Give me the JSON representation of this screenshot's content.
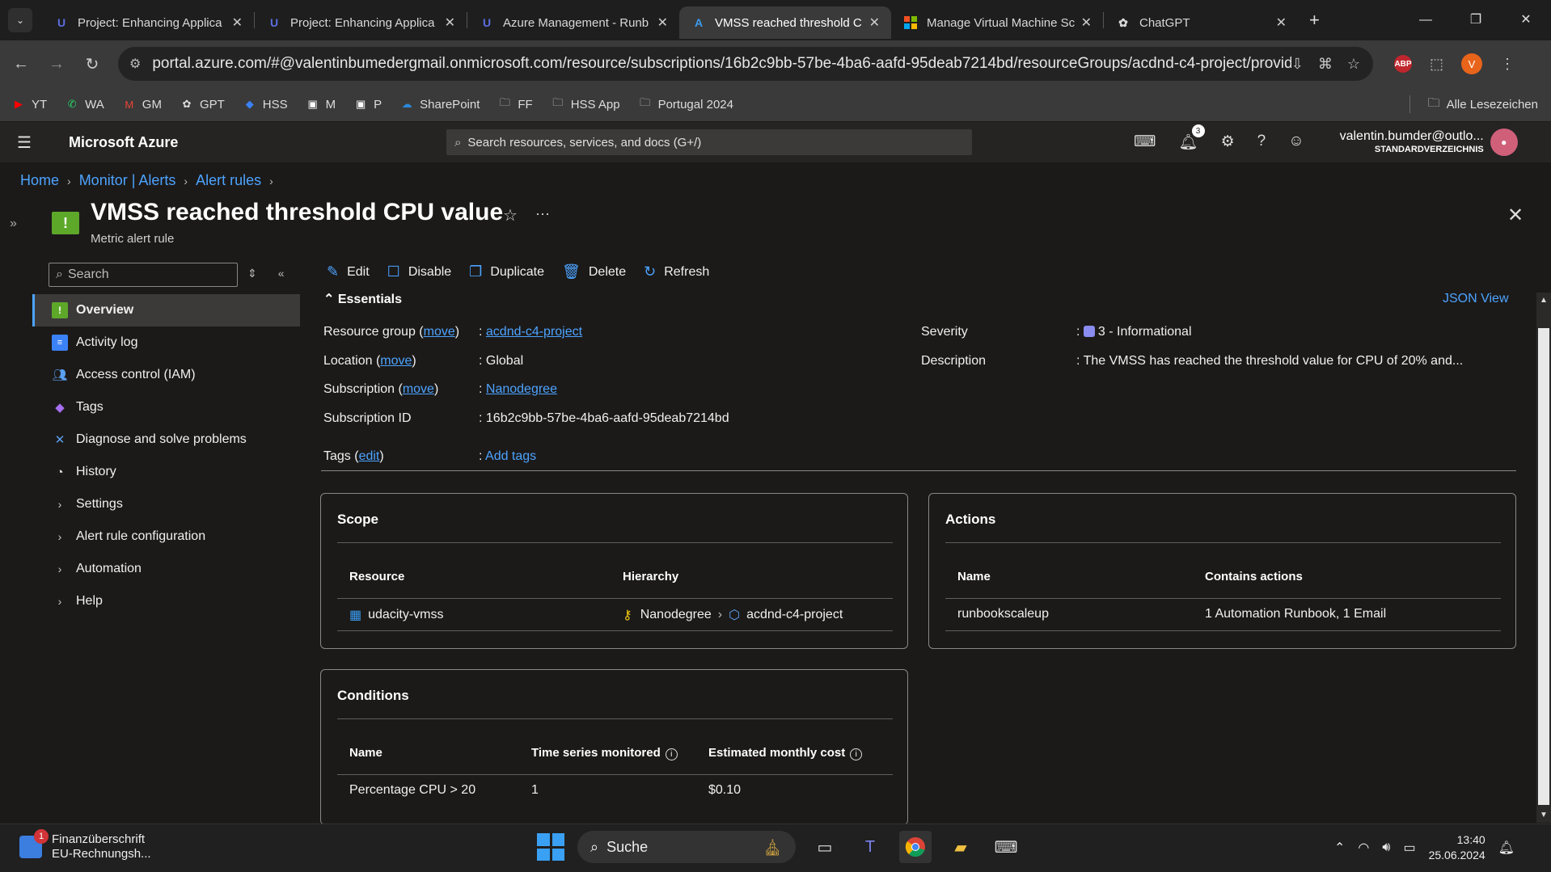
{
  "browser": {
    "tabs": [
      {
        "title": "Project: Enhancing Applica",
        "icon": "udacity-icon",
        "active": false
      },
      {
        "title": "Project: Enhancing Applica",
        "icon": "udacity-icon",
        "active": false
      },
      {
        "title": "Azure Management - Runb",
        "icon": "udacity-icon",
        "active": false
      },
      {
        "title": "VMSS reached threshold C",
        "icon": "azure-icon",
        "active": true
      },
      {
        "title": "Manage Virtual Machine Sc",
        "icon": "microsoft-icon",
        "active": false
      },
      {
        "title": "ChatGPT",
        "icon": "chatgpt-icon",
        "active": false
      }
    ],
    "url": "portal.azure.com/#@valentinbumedergmail.onmicrosoft.com/resource/subscriptions/16b2c9bb-57be-4ba6-aafd-95deab7214bd/resourceGroups/acdnd-c4-project/providers/mi...",
    "profile_initial": "V",
    "abp_label": "ABP",
    "bookmarks": [
      {
        "label": "YT",
        "icon": "youtube-icon",
        "color": "#ff0000"
      },
      {
        "label": "WA",
        "icon": "whatsapp-icon",
        "color": "#25d366"
      },
      {
        "label": "GM",
        "icon": "gmail-icon",
        "color": "#ea4335"
      },
      {
        "label": "GPT",
        "icon": "chatgpt-icon",
        "color": "#dddddd"
      },
      {
        "label": "HSS",
        "icon": "hss-icon",
        "color": "#3b82f6"
      },
      {
        "label": "M",
        "icon": "hm-icon",
        "color": "#ffffff"
      },
      {
        "label": "P",
        "icon": "hm-icon",
        "color": "#ffffff"
      },
      {
        "label": "SharePoint",
        "icon": "cloud-icon",
        "color": "#2b88d8"
      },
      {
        "label": "FF",
        "icon": "folder-icon",
        "color": "#dddddd"
      },
      {
        "label": "HSS App",
        "icon": "folder-icon",
        "color": "#dddddd"
      },
      {
        "label": "Portugal 2024",
        "icon": "folder-icon",
        "color": "#dddddd"
      }
    ],
    "all_bookmarks": "Alle Lesezeichen"
  },
  "azure": {
    "brand": "Microsoft Azure",
    "search_placeholder": "Search resources, services, and docs (G+/)",
    "notification_count": "3",
    "account_email": "valentin.bumder@outlo...",
    "account_directory": "STANDARDVERZEICHNIS"
  },
  "breadcrumb": [
    "Home",
    "Monitor | Alerts",
    "Alert rules"
  ],
  "resource": {
    "title": "VMSS reached threshold CPU value",
    "subtitle": "Metric alert rule"
  },
  "menu": {
    "search_placeholder": "Search",
    "items": [
      {
        "label": "Overview",
        "icon": "overview-icon",
        "active": true
      },
      {
        "label": "Activity log",
        "icon": "activity-log-icon"
      },
      {
        "label": "Access control (IAM)",
        "icon": "iam-icon"
      },
      {
        "label": "Tags",
        "icon": "tag-icon"
      },
      {
        "label": "Diagnose and solve problems",
        "icon": "wrench-icon"
      },
      {
        "label": "History",
        "icon": "clock-icon"
      },
      {
        "label": "Settings",
        "icon": "chevron-right-icon"
      },
      {
        "label": "Alert rule configuration",
        "icon": "chevron-right-icon"
      },
      {
        "label": "Automation",
        "icon": "chevron-right-icon"
      },
      {
        "label": "Help",
        "icon": "chevron-right-icon"
      }
    ]
  },
  "commands": [
    "Edit",
    "Disable",
    "Duplicate",
    "Delete",
    "Refresh"
  ],
  "essentials": {
    "header": "Essentials",
    "json_view": "JSON View",
    "move": "move",
    "edit": "edit",
    "rows": {
      "resource_group_label": "Resource group",
      "resource_group_value": "acdnd-c4-project",
      "location_label": "Location",
      "location_value": "Global",
      "subscription_label": "Subscription",
      "subscription_value": "Nanodegree",
      "subscription_id_label": "Subscription ID",
      "subscription_id_value": "16b2c9bb-57be-4ba6-aafd-95deab7214bd",
      "tags_label": "Tags",
      "tags_value": "Add tags",
      "severity_label": "Severity",
      "severity_value": "3 - Informational",
      "description_label": "Description",
      "description_value": "The VMSS has reached the threshold value for CPU of 20% and..."
    }
  },
  "scope": {
    "title": "Scope",
    "col_resource": "Resource",
    "col_hierarchy": "Hierarchy",
    "resource": "udacity-vmss",
    "hierarchy_sub": "Nanodegree",
    "hierarchy_rg": "acdnd-c4-project"
  },
  "actions": {
    "title": "Actions",
    "col_name": "Name",
    "col_contains": "Contains actions",
    "name": "runbookscaleup",
    "contains": "1 Automation Runbook, 1 Email"
  },
  "conditions": {
    "title": "Conditions",
    "col_name": "Name",
    "col_series": "Time series monitored",
    "col_cost": "Estimated monthly cost",
    "name": "Percentage CPU > 20",
    "series": "1",
    "cost": "$0.10"
  },
  "taskbar": {
    "news_title": "Finanzüberschrift",
    "news_sub": "EU-Rechnungsh...",
    "news_badge": "1",
    "search_label": "Suche",
    "time": "13:40",
    "date": "25.06.2024"
  }
}
